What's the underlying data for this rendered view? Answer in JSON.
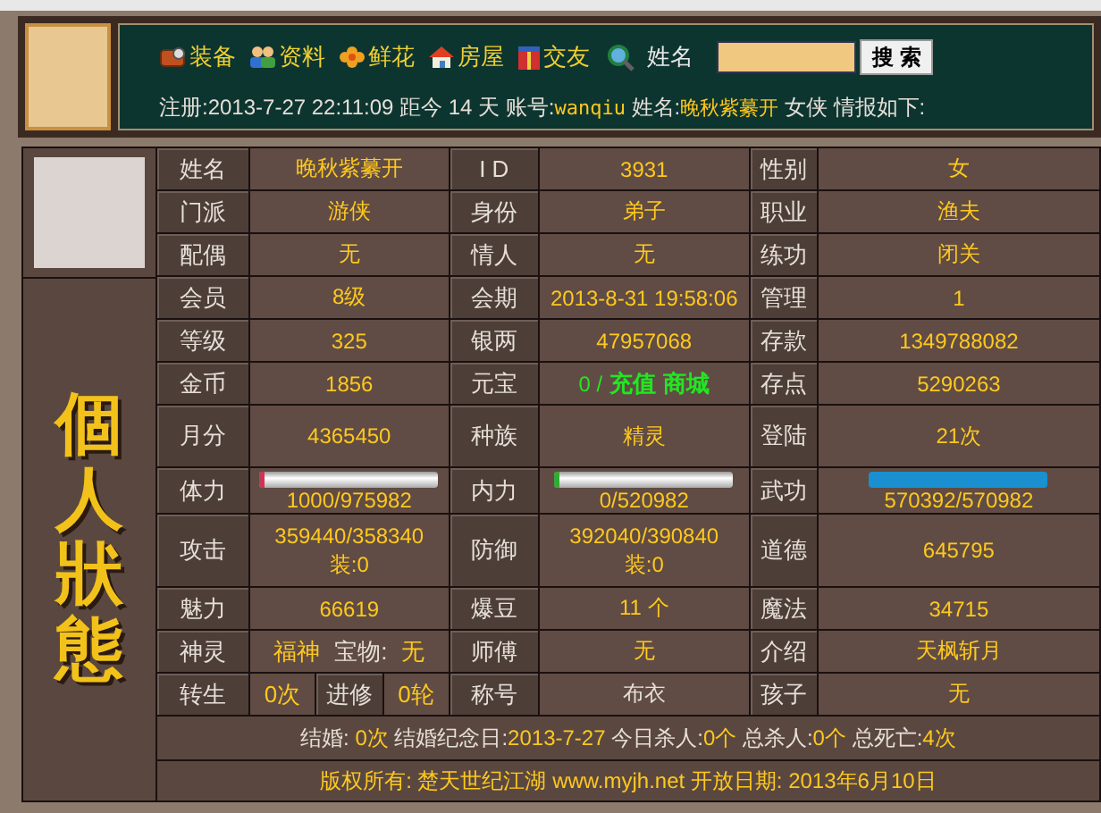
{
  "header": {
    "nav": [
      {
        "label": "装备"
      },
      {
        "label": "资料"
      },
      {
        "label": "鲜花"
      },
      {
        "label": "房屋"
      },
      {
        "label": "交友"
      }
    ],
    "search": {
      "label": "姓名",
      "button": "搜 索"
    },
    "info": [
      {
        "text": "注册:2013-7-27 22:11:09 距今 14 天 账号:",
        "highlight": false
      },
      {
        "text": "wanqiu",
        "highlight": true
      },
      {
        "text": " 姓名:",
        "highlight": false
      },
      {
        "text": "晚秋紫繤开",
        "highlight": true
      },
      {
        "text": " 女侠 情报如下:",
        "highlight": false
      }
    ]
  },
  "side_title": "個人狀態",
  "rows": [
    {
      "cells": [
        {
          "kind": "label",
          "text": "姓名"
        },
        {
          "kind": "value",
          "text": "晚秋紫繤开",
          "highlight": true
        },
        {
          "kind": "label",
          "text": "I D"
        },
        {
          "kind": "value",
          "text": "3931",
          "highlight": true
        },
        {
          "kind": "label",
          "text": "性别"
        },
        {
          "kind": "value",
          "text": "女",
          "highlight": true
        }
      ]
    },
    {
      "cells": [
        {
          "kind": "label",
          "text": "门派"
        },
        {
          "kind": "value",
          "text": "游侠",
          "highlight": true
        },
        {
          "kind": "label",
          "text": "身份"
        },
        {
          "kind": "value",
          "text": "弟子",
          "highlight": true
        },
        {
          "kind": "label",
          "text": "职业"
        },
        {
          "kind": "value",
          "text": "渔夫",
          "highlight": true
        }
      ]
    },
    {
      "cells": [
        {
          "kind": "label",
          "text": "配偶"
        },
        {
          "kind": "value",
          "text": "无",
          "highlight": true
        },
        {
          "kind": "label",
          "text": "情人"
        },
        {
          "kind": "value",
          "text": "无",
          "highlight": true
        },
        {
          "kind": "label",
          "text": "练功"
        },
        {
          "kind": "value",
          "text": "闭关",
          "highlight": true
        }
      ]
    },
    {
      "cells": [
        {
          "kind": "label",
          "text": "会员"
        },
        {
          "kind": "value",
          "text": "8级",
          "highlight": true
        },
        {
          "kind": "label",
          "text": "会期"
        },
        {
          "kind": "value",
          "text": "2013-8-31 19:58:06",
          "highlight": true
        },
        {
          "kind": "label",
          "text": "管理"
        },
        {
          "kind": "value",
          "text": "1",
          "highlight": true
        }
      ]
    },
    {
      "cells": [
        {
          "kind": "label",
          "text": "等级"
        },
        {
          "kind": "value",
          "text": "325",
          "highlight": true
        },
        {
          "kind": "label",
          "text": "银两"
        },
        {
          "kind": "value",
          "text": "47957068",
          "highlight": true
        },
        {
          "kind": "label",
          "text": "存款"
        },
        {
          "kind": "value",
          "text": "1349788082",
          "highlight": true
        }
      ]
    },
    {
      "cells": [
        {
          "kind": "label",
          "text": "金币"
        },
        {
          "kind": "value",
          "text": "1856",
          "highlight": true
        },
        {
          "kind": "label",
          "text": "元宝"
        },
        {
          "kind": "currency",
          "amount": "0 /",
          "links": [
            "充值",
            "商城"
          ]
        },
        {
          "kind": "label",
          "text": "存点"
        },
        {
          "kind": "value",
          "text": "5290263",
          "highlight": true
        }
      ]
    },
    {
      "cells": [
        {
          "kind": "label",
          "text": "月分"
        },
        {
          "kind": "value",
          "text": "4365450",
          "highlight": true
        },
        {
          "kind": "label",
          "text": "种族"
        },
        {
          "kind": "value",
          "text": "精灵",
          "highlight": true
        },
        {
          "kind": "label",
          "text": "登陆"
        },
        {
          "kind": "value",
          "text": "21次",
          "highlight": true
        }
      ]
    },
    {
      "cells": [
        {
          "kind": "label",
          "text": "体力"
        },
        {
          "kind": "bar",
          "level": 0.001,
          "color": "#cc3355",
          "reading": "1000/975982"
        },
        {
          "kind": "label",
          "text": "内力"
        },
        {
          "kind": "bar",
          "level": 0,
          "color": "#33aa33",
          "reading": "0/520982"
        },
        {
          "kind": "label",
          "text": "武功"
        },
        {
          "kind": "bar",
          "level": 1,
          "color": "#1a90d0",
          "reading": "570392/570982"
        }
      ]
    },
    {
      "cells": [
        {
          "kind": "label",
          "text": "攻击"
        },
        {
          "kind": "lines",
          "lines": [
            "359440/358340",
            "装:0"
          ]
        },
        {
          "kind": "label",
          "text": "防御"
        },
        {
          "kind": "lines",
          "lines": [
            "392040/390840",
            "装:0"
          ]
        },
        {
          "kind": "label",
          "text": "道德"
        },
        {
          "kind": "value",
          "text": "645795",
          "highlight": true
        }
      ]
    },
    {
      "cells": [
        {
          "kind": "label",
          "text": "魅力"
        },
        {
          "kind": "value",
          "text": "66619",
          "highlight": true
        },
        {
          "kind": "label",
          "text": "爆豆"
        },
        {
          "kind": "value",
          "text": "11 个",
          "highlight": true
        },
        {
          "kind": "label",
          "text": "魔法"
        },
        {
          "kind": "value",
          "text": "34715",
          "highlight": true
        }
      ]
    },
    {
      "cells": [
        {
          "kind": "label",
          "text": "神灵"
        },
        {
          "kind": "parts",
          "parts": [
            {
              "text": "福神",
              "highlight": true
            },
            {
              "text": "宝物:",
              "highlight": false
            },
            {
              "text": "无",
              "highlight": true
            }
          ]
        },
        {
          "kind": "label",
          "text": "师傅"
        },
        {
          "kind": "value",
          "text": "无",
          "highlight": true
        },
        {
          "kind": "label",
          "text": "介绍"
        },
        {
          "kind": "value",
          "text": "天枫斩月",
          "highlight": true
        }
      ]
    },
    {
      "cells": [
        {
          "kind": "label",
          "text": "转生"
        },
        {
          "kind": "split",
          "parts": [
            {
              "kind": "value",
              "text": "0次"
            },
            {
              "kind": "label",
              "text": "进修"
            },
            {
              "kind": "value",
              "text": "0轮"
            }
          ]
        },
        {
          "kind": "label",
          "text": "称号"
        },
        {
          "kind": "value",
          "text": "布衣",
          "highlight": false
        },
        {
          "kind": "label",
          "text": "孩子"
        },
        {
          "kind": "value",
          "text": "无",
          "highlight": true
        }
      ]
    }
  ],
  "summary": [
    {
      "text": "结婚: ",
      "highlight": false
    },
    {
      "text": "0次",
      "highlight": true
    },
    {
      "text": " 结婚纪念日:",
      "highlight": false
    },
    {
      "text": "2013-7-27",
      "highlight": true
    },
    {
      "text": "  今日杀人:",
      "highlight": false
    },
    {
      "text": "0个",
      "highlight": true
    },
    {
      "text": " 总杀人:",
      "highlight": false
    },
    {
      "text": "0个",
      "highlight": true
    },
    {
      "text": " 总死亡:",
      "highlight": false
    },
    {
      "text": "4次",
      "highlight": true
    }
  ],
  "copyright": "版权所有: 楚天世纪江湖 www.myjh.net    开放日期: 2013年6月10日"
}
